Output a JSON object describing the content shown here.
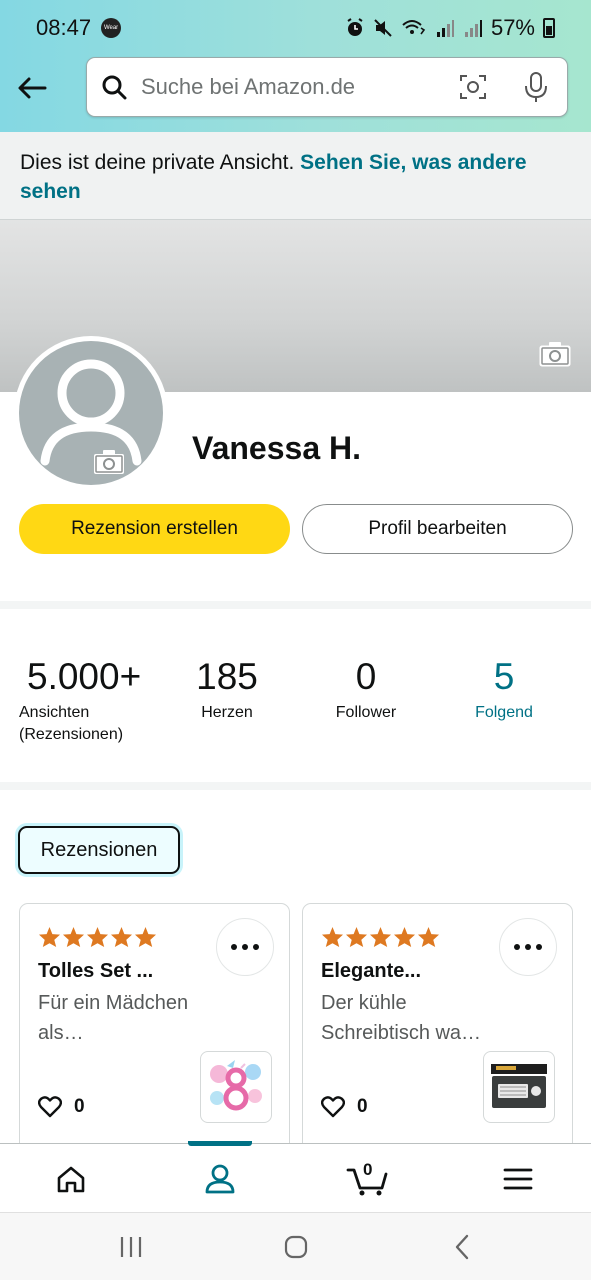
{
  "status_bar": {
    "time": "08:47",
    "app_badge": "Wear",
    "battery": "57%"
  },
  "header": {
    "search_placeholder": "Suche bei Amazon.de"
  },
  "notice": {
    "text": "Dies ist deine private Ansicht. ",
    "link": "Sehen Sie, was andere sehen"
  },
  "profile": {
    "name": "Vanessa H.",
    "review_button": "Rezension erstellen",
    "edit_button": "Profil bearbeiten"
  },
  "stats": [
    {
      "value": "5.000+",
      "label_line1": "Ansichten",
      "label_line2": "(Rezensionen)"
    },
    {
      "value": "185",
      "label_line1": "Herzen"
    },
    {
      "value": "0",
      "label_line1": "Follower"
    },
    {
      "value": "5",
      "label_line1": "Folgend"
    }
  ],
  "tabs": {
    "active": "Rezensionen"
  },
  "reviews": [
    {
      "rating": 5,
      "title": "Tolles Set ...",
      "text_line1": "Für ein Mädchen",
      "text_line2": "als…",
      "likes": "0",
      "thumb_icon": "balloon-8-icon"
    },
    {
      "rating": 5,
      "title": "Elegante...",
      "text_line1": "Der kühle",
      "text_line2": "Schreibtisch wa…",
      "likes": "0",
      "thumb_icon": "desk-mat-icon"
    }
  ],
  "bottom_nav": {
    "cart_count": "0",
    "active": "profile"
  },
  "colors": {
    "accent_teal": "#007185",
    "button_yellow": "#ffd814",
    "star_orange": "#de7921"
  }
}
